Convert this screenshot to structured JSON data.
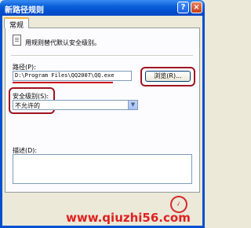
{
  "window": {
    "title": "新路径规则",
    "help_label": "?",
    "close_label": "×"
  },
  "tabs": [
    {
      "label": "常规"
    }
  ],
  "description": "用规则替代默认安全级别。",
  "path": {
    "label": "路径(P):",
    "value": "D:\\Program Files\\QQ2007\\QQ.exe",
    "browse_label": "浏览(R)..."
  },
  "security": {
    "label": "安全级别(S):",
    "selected": "不允许的"
  },
  "notes": {
    "label": "描述(D):",
    "value": ""
  },
  "watermark": {
    "text": "www.qiuzhi56.com"
  },
  "colors": {
    "titlebar": "#0450d0",
    "annotation": "#cc1020",
    "watermark": "#e02020"
  }
}
